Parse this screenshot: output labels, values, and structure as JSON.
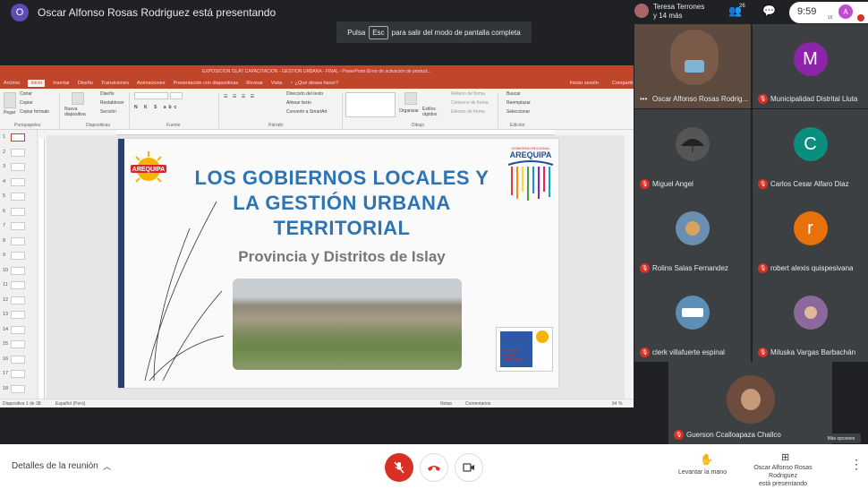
{
  "top": {
    "presenter_initial": "O",
    "presenter_text": "Oscar Alfonso Rosas Rodriguez está presentando",
    "esc_hint_before": "Pulsa",
    "esc_key": "Esc",
    "esc_hint_after": "para salir del modo de pantalla completa"
  },
  "right_header": {
    "participants_line1": "Teresa Terrones",
    "participants_line2": "y 14 más",
    "people_count": "26",
    "clock": "9:59",
    "user_initial": "A",
    "user_sub": "16"
  },
  "ppt": {
    "title": "EXPOSICION ISLAY CAPACITACION - GESTION URBANA - FINAL - PowerPoint (Error de activación de product...",
    "tabs": [
      "Archivo",
      "Inicio",
      "Insertar",
      "Diseño",
      "Transiciones",
      "Animaciones",
      "Presentación con diapositivas",
      "Revisar",
      "Vista",
      "♀ ¿Qué desea hacer?"
    ],
    "active_tab": "Inicio",
    "tab_right": "Iniciar sesión",
    "tab_share": "Compartir",
    "ribbon": {
      "cortar": "Cortar",
      "copiar": "Copiar",
      "copiar_formato": "Copiar formato",
      "pegar": "Pegar",
      "portapapeles": "Portapapeles",
      "nueva_diapositiva": "Nueva diapositiva",
      "diseno": "Diseño",
      "restablecer": "Restablecer",
      "seccion": "Sección",
      "diapositivas": "Diapositivas",
      "fuente": "Fuente",
      "direccion_texto": "Dirección del texto",
      "alinear_texto": "Alinear texto",
      "convertir_smartart": "Convertir a SmartArt",
      "parrafo": "Párrafo",
      "organizar": "Organizar",
      "estilos_rapidos": "Estilos rápidos",
      "relleno_forma": "Relleno de forma",
      "contorno_forma": "Contorno de forma",
      "efectos_forma": "Efectos de forma",
      "dibujo": "Dibujo",
      "buscar": "Buscar",
      "reemplazar": "Reemplazar",
      "seleccionar": "Seleccionar",
      "edicion": "Edición"
    },
    "slide_numbers": [
      "1",
      "2",
      "3",
      "4",
      "5",
      "6",
      "7",
      "8",
      "9",
      "10",
      "11",
      "12",
      "13",
      "14",
      "15",
      "16",
      "17",
      "18"
    ],
    "slide": {
      "logo_text": "AREQUIPA",
      "gob_small": "GOBIERNO REGIONAL",
      "gob_name": "AREQUIPA",
      "title_line1": "LOS GOBIERNOS LOCALES Y",
      "title_line2": "LA GESTIÓN URBANA",
      "title_line3": "TERRITORIAL",
      "subtitle": "Provincia y Distritos de Islay",
      "vivienda_line1": "Vivienda",
      "vivienda_line2": "y Agua",
      "vivienda_line3": "Para Todos"
    },
    "status_left": "Diapositiva 1 de 38",
    "status_lang": "Español (Perú)",
    "status_notes": "Notas",
    "status_comments": "Comentarios",
    "status_zoom": "64 %"
  },
  "participants": [
    {
      "name": "Oscar Alfonso Rosas Rodrig...",
      "type": "video",
      "muted": false
    },
    {
      "name": "Municipalidad Distrital Lluta",
      "initial": "M",
      "color": "#8e24aa",
      "muted": true
    },
    {
      "name": "Miguel Angel",
      "initial": "",
      "color": "#555",
      "muted": true
    },
    {
      "name": "Carlos Cesar Alfaro Diaz",
      "initial": "C",
      "color": "#0a8f7f",
      "muted": true
    },
    {
      "name": "Rolins Salas Fernandez",
      "initial": "",
      "color": "#6a8fb3",
      "muted": true
    },
    {
      "name": "robert alexis quispesivana",
      "initial": "r",
      "color": "#e8710a",
      "muted": true
    },
    {
      "name": "clerk villafuerte espinal",
      "initial": "",
      "color": "#5b8fb8",
      "muted": true
    },
    {
      "name": "Miluska Vargas Barbachán",
      "initial": "",
      "color": "#8b6a9b",
      "muted": true
    },
    {
      "name": "Guerson Ccalloapaza Challco",
      "initial": "",
      "color": "#6d4c3d",
      "muted": true
    }
  ],
  "more_options": "Más opciones",
  "bottom": {
    "meeting_details": "Detalles de la reunión",
    "raise_hand": "Levantar la mano",
    "present_line1": "Oscar Alfonso Rosas Rodriguez",
    "present_line2": "está presentando"
  }
}
